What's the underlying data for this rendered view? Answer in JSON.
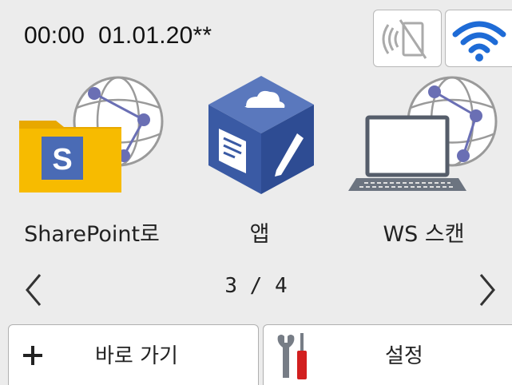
{
  "status_bar": {
    "datetime": "00:00  01.01.20**",
    "nfc_icon": "nfc-disabled-icon",
    "wifi_icon": "wifi-icon"
  },
  "tiles": [
    {
      "label": "SharePoint로",
      "icon": "sharepoint-folder-icon",
      "badge": "S"
    },
    {
      "label": "앱",
      "icon": "apps-cube-icon"
    },
    {
      "label": "WS 스캔",
      "icon": "ws-scan-laptop-icon"
    }
  ],
  "pager": {
    "current": "3 / 4",
    "prev_icon": "chevron-left-icon",
    "next_icon": "chevron-right-icon"
  },
  "bottom_bar": {
    "shortcut_label": "바로 가기",
    "settings_label": "설정"
  },
  "colors": {
    "background": "#ececec",
    "folder": "#f5b800",
    "badge": "#4a6bb5",
    "cube": "#3e5fa8",
    "tool_red": "#d21f1f"
  }
}
